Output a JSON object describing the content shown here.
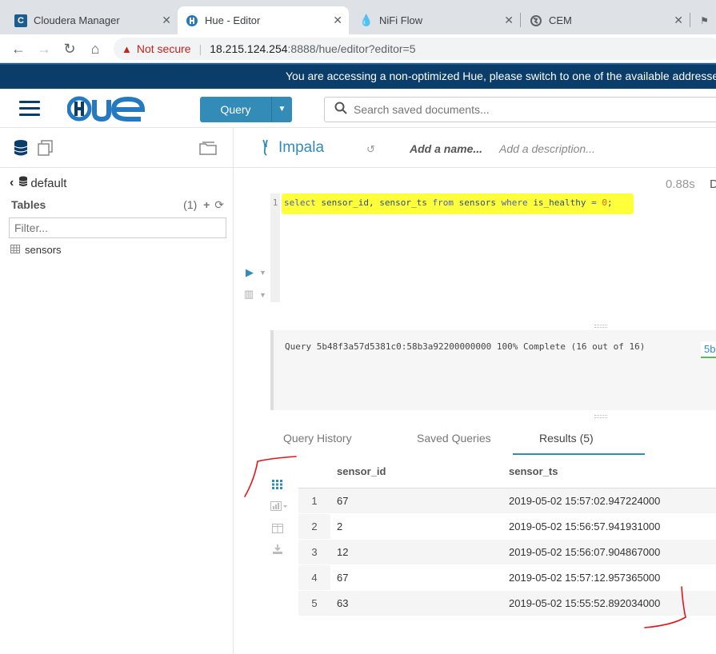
{
  "browser": {
    "tabs": [
      {
        "title": "Cloudera Manager"
      },
      {
        "title": "Hue - Editor"
      },
      {
        "title": "NiFi Flow"
      },
      {
        "title": "CEM"
      }
    ],
    "security_label": "Not secure",
    "url_host": "18.215.124.254",
    "url_path": ":8888/hue/editor?editor=5"
  },
  "banner": {
    "text": "You are accessing a non-optimized Hue, please switch to one of the available addresses"
  },
  "header": {
    "logo": "HUE",
    "query_button": "Query",
    "search_placeholder": "Search saved documents..."
  },
  "left_panel": {
    "database": "default",
    "tables_label": "Tables",
    "tables_count": "(1)",
    "filter_placeholder": "Filter...",
    "tables": [
      "sensors"
    ]
  },
  "editor": {
    "engine": "Impala",
    "name_placeholder": "Add a name...",
    "description_placeholder": "Add a description...",
    "elapsed": "0.88s",
    "elapsed_suffix": "D",
    "line_number": "1",
    "query_tokens": {
      "select": "select",
      "cols": "sensor_id, sensor_ts",
      "from": "from",
      "table": "sensors",
      "where": "where",
      "cond": "is_healthy",
      "eq": "=",
      "val": "0",
      "end": ";"
    }
  },
  "status": {
    "text": "Query 5b48f3a57d5381c0:58b3a92200000000 100% Complete (16 out of 16)",
    "badge": "5b"
  },
  "result_tabs": {
    "history": "Query History",
    "saved": "Saved Queries",
    "results": "Results (5)"
  },
  "results": {
    "columns": [
      "sensor_id",
      "sensor_ts"
    ],
    "rows": [
      {
        "n": "1",
        "sensor_id": "67",
        "sensor_ts": "2019-05-02 15:57:02.947224000"
      },
      {
        "n": "2",
        "sensor_id": "2",
        "sensor_ts": "2019-05-02 15:56:57.941931000"
      },
      {
        "n": "3",
        "sensor_id": "12",
        "sensor_ts": "2019-05-02 15:56:07.904867000"
      },
      {
        "n": "4",
        "sensor_id": "67",
        "sensor_ts": "2019-05-02 15:57:12.957365000"
      },
      {
        "n": "5",
        "sensor_id": "63",
        "sensor_ts": "2019-05-02 15:55:52.892034000"
      }
    ]
  },
  "colors": {
    "accent": "#338bb8",
    "banner": "#0b3d6b",
    "highlight": "#ffff3a",
    "annotation": "#e0161b"
  }
}
